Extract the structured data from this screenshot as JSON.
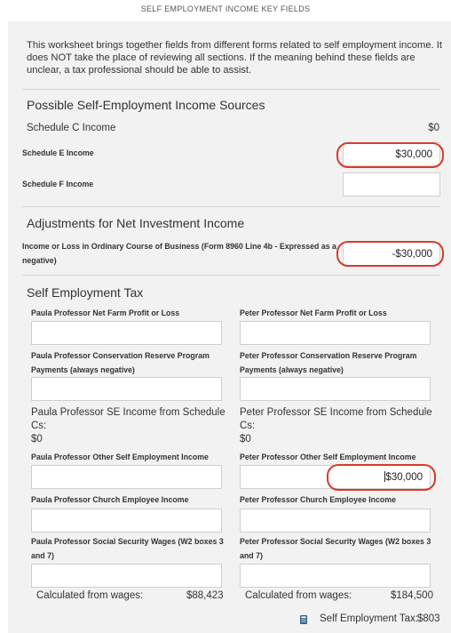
{
  "header": {
    "title": "SELF EMPLOYMENT INCOME KEY FIELDS"
  },
  "intro": {
    "text": "This worksheet brings together fields from different forms related to self employment income. It does NOT take the place of reviewing all sections. If the meaning behind these fields are unclear, a tax professional should be able to assist."
  },
  "possible_sources": {
    "heading": "Possible Self-Employment Income Sources",
    "schedule_c": {
      "label": "Schedule C Income",
      "value": "$0"
    },
    "schedule_e": {
      "label": "Schedule E Income",
      "value": "$30,000"
    },
    "schedule_f": {
      "label": "Schedule F Income",
      "value": ""
    }
  },
  "adjustments": {
    "heading": "Adjustments for Net Investment Income",
    "ordinary_income": {
      "label": "Income or Loss in Ordinary Course of Business (Form 8960 Line 4b - Expressed as a negative)",
      "value": "-$30,000"
    }
  },
  "se_tax": {
    "heading": "Self Employment Tax",
    "paula": {
      "net_farm_label": "Paula Professor Net Farm Profit or Loss",
      "net_farm_value": "",
      "crp_label": "Paula Professor Conservation Reserve Program Payments (always negative)",
      "crp_value": "",
      "se_sched_c_label": "Paula Professor SE Income from Schedule Cs:",
      "se_sched_c_value": "$0",
      "other_se_label": "Paula Professor Other Self Employment Income",
      "other_se_value": "",
      "church_label": "Paula Professor Church Employee Income",
      "church_value": "",
      "ss_wages_label": "Paula Professor Social Security Wages (W2 boxes 3 and 7)",
      "ss_wages_value": "",
      "calc_label": "Calculated from wages:",
      "calc_value": "$88,423"
    },
    "peter": {
      "net_farm_label": "Peter Professor Net Farm Profit or Loss",
      "net_farm_value": "",
      "crp_label": "Peter Professor Conservation Reserve Program Payments (always negative)",
      "crp_value": "",
      "se_sched_c_label": "Peter Professor SE Income from Schedule Cs:",
      "se_sched_c_value": "$0",
      "other_se_label": "Peter Professor Other Self Employment Income",
      "other_se_value": "30,000",
      "other_se_prefix": "$",
      "church_label": "Peter Professor Church Employee Income",
      "church_value": "",
      "ss_wages_label": "Peter Professor Social Security Wages (W2 boxes 3 and 7)",
      "ss_wages_value": "",
      "calc_label": "Calculated from wages:",
      "calc_value": "$184,500"
    },
    "total_label": "Self Employment Tax:",
    "total_value": "$803",
    "total_icon": "calculator-icon"
  },
  "colors": {
    "highlight": "#d93a2b",
    "panel": "#f2f2f2",
    "input_border": "#cfcfcf"
  }
}
